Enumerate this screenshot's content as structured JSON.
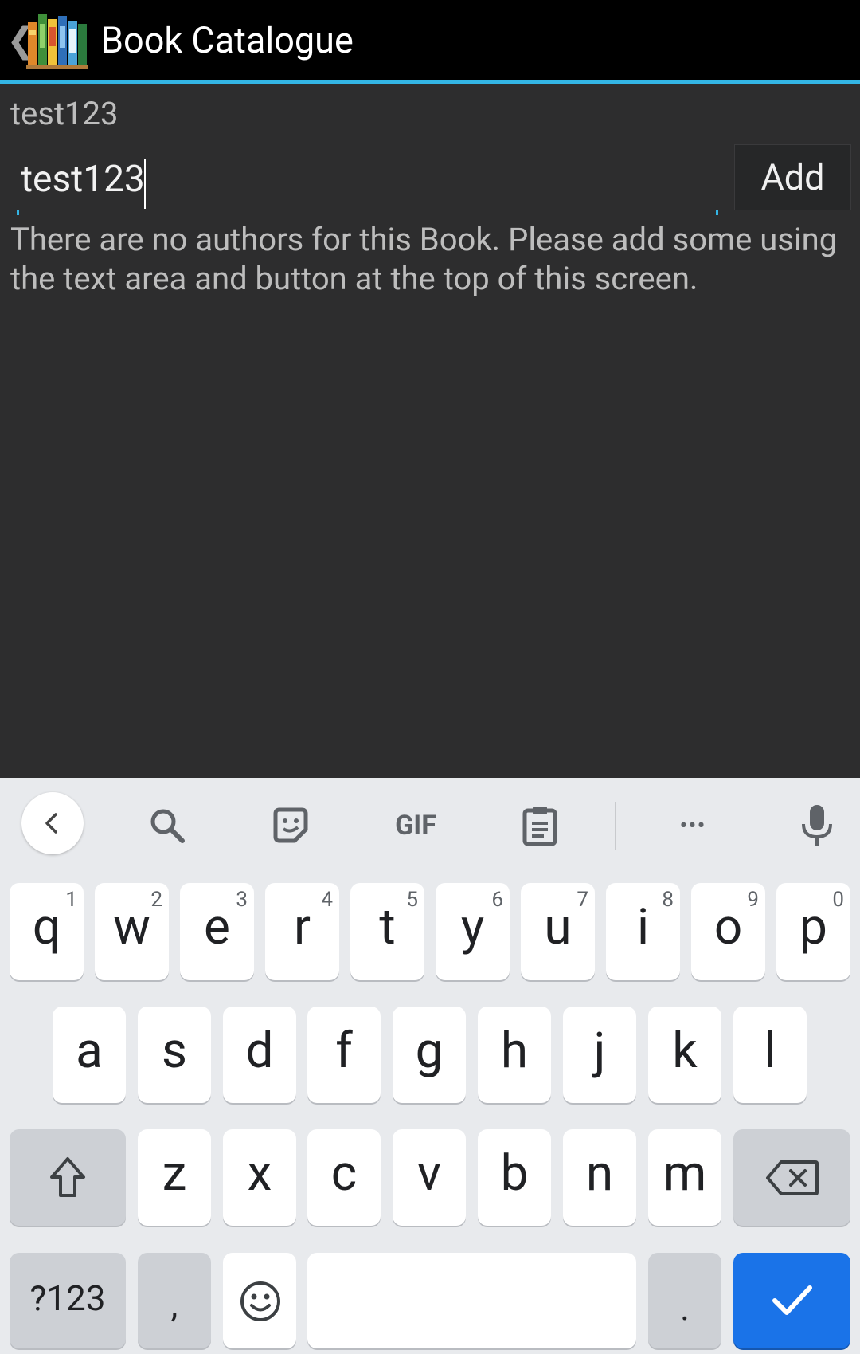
{
  "action_bar": {
    "title": "Book Catalogue",
    "back_glyph": "❮"
  },
  "content": {
    "book_title": "test123",
    "author_input_value": "test123",
    "add_button_label": "Add",
    "empty_message": "There are no authors for this Book. Please add some using the text area and button at the top of this screen."
  },
  "keyboard": {
    "toolbar": {
      "items": [
        "back-icon",
        "search-icon",
        "sticker-icon",
        "gif-icon",
        "clipboard-icon",
        "more-icon",
        "mic-icon"
      ],
      "gif_label": "GIF",
      "more_label": "•••"
    },
    "row1": [
      {
        "key": "q",
        "hint": "1"
      },
      {
        "key": "w",
        "hint": "2"
      },
      {
        "key": "e",
        "hint": "3"
      },
      {
        "key": "r",
        "hint": "4"
      },
      {
        "key": "t",
        "hint": "5"
      },
      {
        "key": "y",
        "hint": "6"
      },
      {
        "key": "u",
        "hint": "7"
      },
      {
        "key": "i",
        "hint": "8"
      },
      {
        "key": "o",
        "hint": "9"
      },
      {
        "key": "p",
        "hint": "0"
      }
    ],
    "row2": [
      "a",
      "s",
      "d",
      "f",
      "g",
      "h",
      "j",
      "k",
      "l"
    ],
    "row3": [
      "z",
      "x",
      "c",
      "v",
      "b",
      "n",
      "m"
    ],
    "symbols_label": "?123",
    "comma_label": ",",
    "period_label": ".",
    "accent_color": "#1a73e8"
  }
}
